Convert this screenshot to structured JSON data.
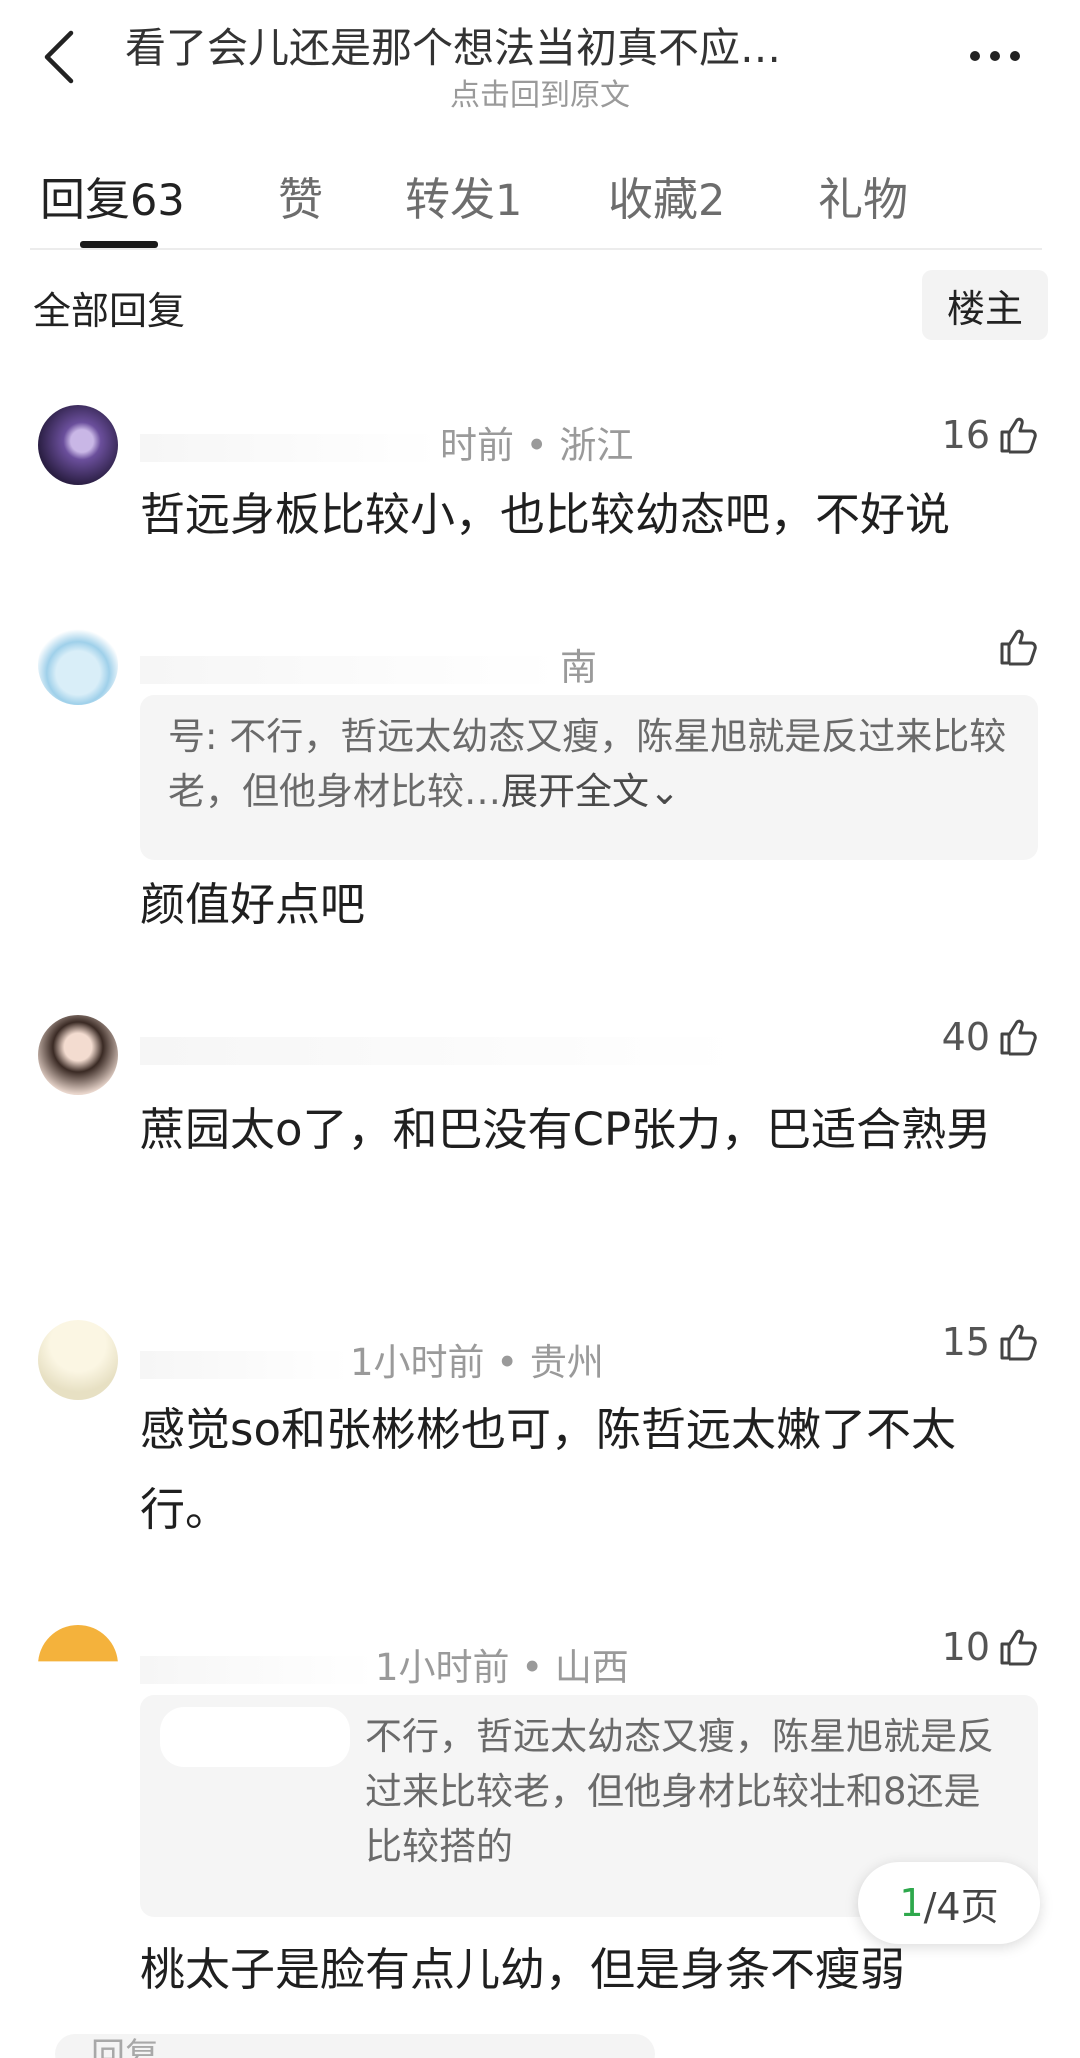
{
  "header": {
    "title": "看了会儿还是那个想法当初真不应…",
    "subtitle": "点击回到原文"
  },
  "tabs": [
    {
      "label": "回复",
      "count": "63"
    },
    {
      "label": "赞",
      "count": ""
    },
    {
      "label": "转发",
      "count": "1"
    },
    {
      "label": "收藏",
      "count": "2"
    },
    {
      "label": "礼物",
      "count": ""
    }
  ],
  "filter": {
    "label": "全部回复",
    "owner_button": "楼主"
  },
  "comments": [
    {
      "meta": "时前 • 浙江",
      "likes": "16",
      "text": "哲远身板比较小，也比较幼态吧，不好说"
    },
    {
      "meta": "南",
      "likes": "",
      "quote": "号: 不行，哲远太幼态又瘦，陈星旭就是反过来比较老，但他身材比较…",
      "quote_expand": "展开全文",
      "text": "颜值好点吧"
    },
    {
      "meta": "",
      "likes": "40",
      "text": "蔗园太o了，和巴没有CP张力，巴适合熟男"
    },
    {
      "meta": "1小时前 • 贵州",
      "likes": "15",
      "text": "感觉so和张彬彬也可，陈哲远太嫩了不太行。"
    },
    {
      "meta": "1小时前 • 山西",
      "likes": "10",
      "quote": "不行，哲远太幼态又瘦，陈星旭就是反过来比较老，但他身材比较壮和8还是比较搭的",
      "text": "桃太子是脸有点儿幼，但是身条不瘦弱"
    }
  ],
  "pagination": {
    "current": "1",
    "total_label": "/4页"
  },
  "bottom_bar": {
    "input_placeholder": "回复"
  },
  "colors": {
    "accent_green": "#2ea84c",
    "quote_bg": "#f5f5f5",
    "meta_gray": "#9a9a9a"
  },
  "icons": [
    "back-icon",
    "more-icon",
    "like-icon"
  ]
}
